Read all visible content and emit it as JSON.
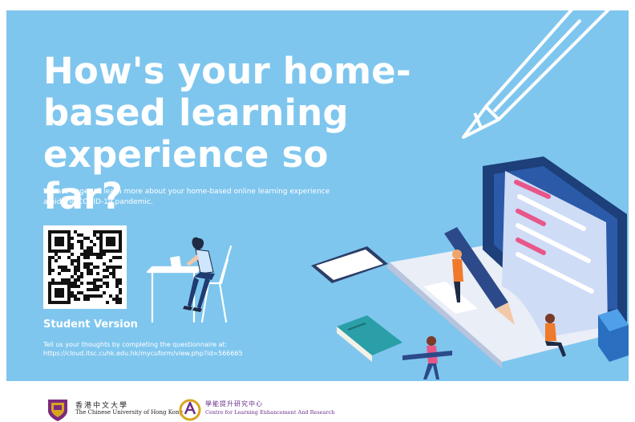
{
  "poster": {
    "headline": "How's your home-based learning experience so far?",
    "intro": "We are eager to learn more about your home-based online learning experience amid the COVID-19 pandemic.",
    "version_label": "Student Version",
    "cta_text": "Tell us your thoughts by completing the questionnaire at:",
    "url": "https://cloud.itsc.cuhk.edu.hk/mycuform/view.php?id=566665",
    "background_color": "#7fc6ee"
  },
  "footer": {
    "logo1_chinese": "香港中文大學",
    "logo1_english": "The Chinese University of Hong Kong",
    "logo2_chinese": "學能提升研究中心",
    "logo2_english": "Centre for Learning Enhancement And Research"
  }
}
